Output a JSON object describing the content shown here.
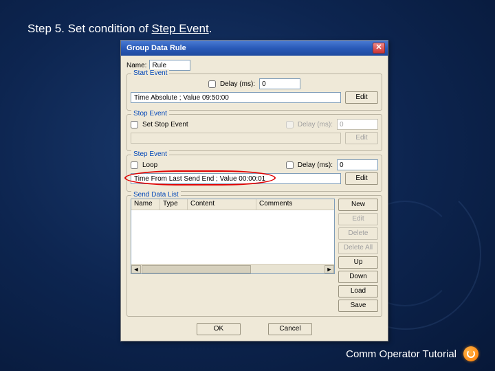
{
  "instruction": {
    "prefix": "Step 5. Set condition of ",
    "emph": "Step Event",
    "suffix": "."
  },
  "footer": {
    "text": "Comm Operator Tutorial"
  },
  "window": {
    "title": "Group Data Rule",
    "name_label": "Name:",
    "name_value": "Rule",
    "start_event": {
      "title": "Start Event",
      "delay_label": "Delay (ms):",
      "delay_value": "0",
      "value_text": "Time Absolute ; Value 09:50:00",
      "edit": "Edit"
    },
    "stop_event": {
      "title": "Stop Event",
      "set_label": "Set Stop Event",
      "delay_label": "Delay (ms):",
      "delay_value": "0",
      "value_text": "",
      "edit": "Edit"
    },
    "step_event": {
      "title": "Step Event",
      "loop_label": "Loop",
      "delay_label": "Delay (ms):",
      "delay_value": "0",
      "value_text": "Time From Last Send End ; Value 00:00:01",
      "edit": "Edit"
    },
    "send_list": {
      "title": "Send Data List",
      "cols": {
        "name": "Name",
        "type": "Type",
        "content": "Content",
        "comments": "Comments"
      },
      "buttons": {
        "new": "New",
        "edit": "Edit",
        "delete": "Delete",
        "delete_all": "Delete All",
        "up": "Up",
        "down": "Down",
        "load": "Load",
        "save": "Save"
      }
    },
    "ok": "OK",
    "cancel": "Cancel"
  }
}
